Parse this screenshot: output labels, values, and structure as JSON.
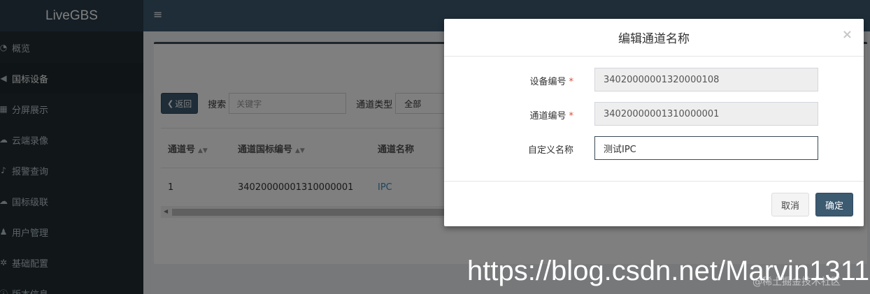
{
  "app": {
    "logo": "LiveGBS"
  },
  "sidebar": {
    "items": [
      {
        "label": "概览",
        "icon": "dashboard-icon",
        "glyph": "◔"
      },
      {
        "label": "国标设备",
        "icon": "video-camera-icon",
        "glyph": "◀"
      },
      {
        "label": "分屏展示",
        "icon": "grid-icon",
        "glyph": "▦"
      },
      {
        "label": "云端录像",
        "icon": "cloud-icon",
        "glyph": "☁"
      },
      {
        "label": "报警查询",
        "icon": "bell-icon",
        "glyph": "♪"
      },
      {
        "label": "国标级联",
        "icon": "cloud-upload-icon",
        "glyph": "☁"
      },
      {
        "label": "用户管理",
        "icon": "users-icon",
        "glyph": "♟"
      },
      {
        "label": "基础配置",
        "icon": "cogs-icon",
        "glyph": "✲"
      },
      {
        "label": "版本信息",
        "icon": "info-icon",
        "glyph": "ⓘ"
      }
    ],
    "active_index": 1
  },
  "toolbar": {
    "back_label": "返回",
    "search_label": "搜索",
    "search_placeholder": "关键字",
    "channel_type_label": "通道类型",
    "channel_type_value": "全部"
  },
  "table": {
    "headers": [
      "通道号",
      "通道国标编号",
      "通道名称"
    ],
    "rows": [
      {
        "channel_no": "1",
        "channel_gb_id": "34020000001310000001",
        "channel_name": "IPC"
      }
    ]
  },
  "modal": {
    "title": "编辑通道名称",
    "close": "×",
    "fields": {
      "device_id_label": "设备编号",
      "device_id_value": "34020000001320000108",
      "channel_id_label": "通道编号",
      "channel_id_value": "34020000001310000001",
      "custom_name_label": "自定义名称",
      "custom_name_value": "测试IPC",
      "required_mark": "*"
    },
    "cancel_label": "取消",
    "ok_label": "确定"
  },
  "watermarks": {
    "url": "https://blog.csdn.net/Marvin1311",
    "community": "@稀土掘金技术社区"
  },
  "colors": {
    "sidebar_bg": "#222d32",
    "topbar_bg": "#3c5a70",
    "primary_btn": "#3c5a70",
    "required": "#dd4b39"
  }
}
